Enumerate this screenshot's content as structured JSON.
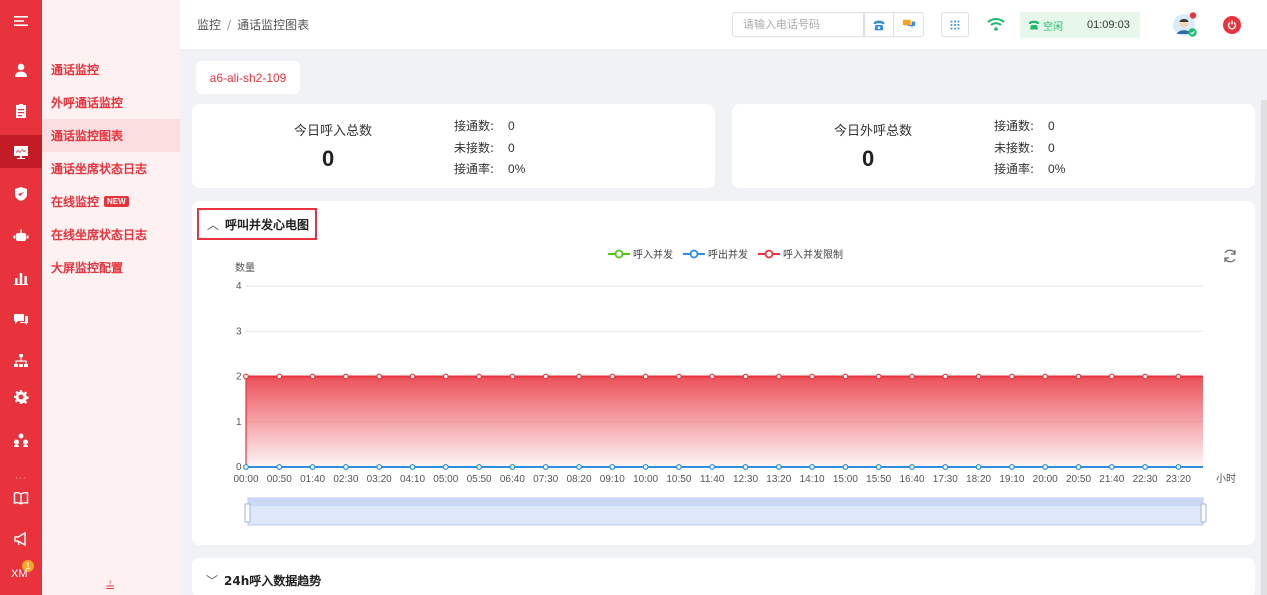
{
  "submenu": {
    "items": [
      {
        "label": "通话监控"
      },
      {
        "label": "外呼通话监控"
      },
      {
        "label": "通话监控图表"
      },
      {
        "label": "通话坐席状态日志"
      },
      {
        "label": "在线监控",
        "tag": "NEW"
      },
      {
        "label": "在线坐席状态日志"
      },
      {
        "label": "大屏监控配置"
      }
    ],
    "active_index": 2
  },
  "rail": {
    "badge_count": "1",
    "brand_text": "XM"
  },
  "header": {
    "breadcrumb": [
      "监控",
      "通话监控图表"
    ],
    "phone_placeholder": "请输入电话号码",
    "status_label": "空闲",
    "timer": "01:09:03"
  },
  "server_tag": "a6-ali-sh2-109",
  "stats": {
    "inbound": {
      "title": "今日呼入总数",
      "total": "0",
      "connected_label": "接通数:",
      "connected": "0",
      "missed_label": "未接数:",
      "missed": "0",
      "rate_label": "接通率:",
      "rate": "0%"
    },
    "outbound": {
      "title": "今日外呼总数",
      "total": "0",
      "connected_label": "接通数:",
      "connected": "0",
      "missed_label": "未接数:",
      "missed": "0",
      "rate_label": "接通率:",
      "rate": "0%"
    }
  },
  "chart_section": {
    "title": "呼叫并发心电图"
  },
  "trend_section": {
    "title": "24h呼入数据趋势"
  },
  "colors": {
    "accent": "#e8323c",
    "inbound": "#52c41a",
    "outbound": "#2f8ee0",
    "limit": "#e8323c"
  },
  "chart_data": {
    "type": "area",
    "ylabel": "数量",
    "xlabel": "小时",
    "ylim": [
      0,
      4
    ],
    "yticks": [
      0,
      1,
      2,
      3,
      4
    ],
    "x": [
      "00:00",
      "00:50",
      "01:40",
      "02:30",
      "03:20",
      "04:10",
      "05:00",
      "05:50",
      "06:40",
      "07:30",
      "08:20",
      "09:10",
      "10:00",
      "10:50",
      "11:40",
      "12:30",
      "13:20",
      "14:10",
      "15:00",
      "15:50",
      "16:40",
      "17:30",
      "18:20",
      "19:10",
      "20:00",
      "20:50",
      "21:40",
      "22:30",
      "23:20"
    ],
    "series": [
      {
        "name": "呼入并发",
        "color": "#52c41a",
        "values": [
          0,
          0,
          0,
          0,
          0,
          0,
          0,
          0,
          0,
          0,
          0,
          0,
          0,
          0,
          0,
          0,
          0,
          0,
          0,
          0,
          0,
          0,
          0,
          0,
          0,
          0,
          0,
          0,
          0
        ]
      },
      {
        "name": "呼出并发",
        "color": "#2f8ee0",
        "values": [
          0,
          0,
          0,
          0,
          0,
          0,
          0,
          0,
          0,
          0,
          0,
          0,
          0,
          0,
          0,
          0,
          0,
          0,
          0,
          0,
          0,
          0,
          0,
          0,
          0,
          0,
          0,
          0,
          0
        ]
      },
      {
        "name": "呼入并发限制",
        "color": "#e8323c",
        "values": [
          2,
          2,
          2,
          2,
          2,
          2,
          2,
          2,
          2,
          2,
          2,
          2,
          2,
          2,
          2,
          2,
          2,
          2,
          2,
          2,
          2,
          2,
          2,
          2,
          2,
          2,
          2,
          2,
          2
        ]
      }
    ],
    "grid": true,
    "legend": "top-center"
  }
}
